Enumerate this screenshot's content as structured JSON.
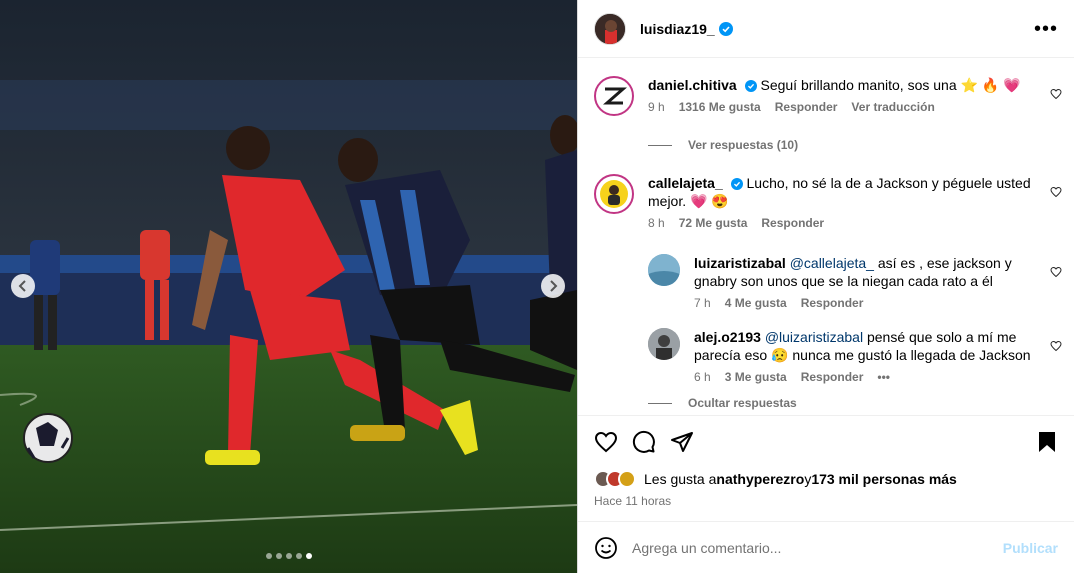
{
  "post": {
    "author": "luisdiaz19_",
    "more_icon": "more-horizontal-icon",
    "carousel": {
      "total_slides": 5,
      "active_slide": 5
    }
  },
  "comments": [
    {
      "username": "daniel.chitiva",
      "verified": true,
      "text": "Seguí brillando manito, sos una ⭐ 🔥 💗",
      "time": "9 h",
      "likes": "1316 Me gusta",
      "reply": "Responder",
      "translate": "Ver traducción",
      "view_replies": "Ver respuestas (10)"
    },
    {
      "username": "callelajeta_",
      "verified": true,
      "text": "Lucho, no sé la de a Jackson y péguele usted mejor. 💗 😍",
      "time": "8 h",
      "likes": "72 Me gusta",
      "reply": "Responder",
      "replies": [
        {
          "username": "luizaristizabal",
          "mention": "@callelajeta_",
          "text": " así es , ese jackson y gnabry son unos que se la niegan cada rato a él",
          "time": "7 h",
          "likes": "4 Me gusta",
          "reply": "Responder"
        },
        {
          "username": "alej.o2193",
          "mention": "@luizaristizabal",
          "text": " pensé que solo a mí me parecía eso 😥 nunca me gustó la llegada de Jackson",
          "time": "6 h",
          "likes": "3 Me gusta",
          "reply": "Responder",
          "more": "•••"
        }
      ],
      "hide_replies": "Ocultar respuestas"
    }
  ],
  "actions": {
    "likes_prefix": "Les gusta a ",
    "liked_by": "nathyperezro",
    "likes_mid": " y ",
    "likes_others": "173 mil personas más",
    "posted_ago": "Hace 11 horas"
  },
  "comment_box": {
    "placeholder": "Agrega un comentario...",
    "publish": "Publicar"
  },
  "colors": {
    "verified": "#0095f6",
    "mention": "#00376b",
    "publish_disabled": "#b2dffc",
    "muted": "#737373"
  }
}
